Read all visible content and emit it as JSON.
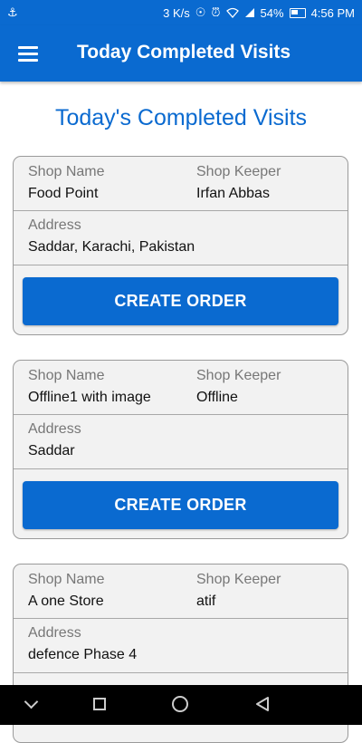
{
  "status_bar": {
    "speed": "3 K/s",
    "battery": "54%",
    "time": "4:56 PM"
  },
  "app_bar": {
    "title": "Today Completed Visits"
  },
  "page": {
    "heading": "Today's Completed Visits"
  },
  "labels": {
    "shop_name": "Shop Name",
    "shop_keeper": "Shop Keeper",
    "address": "Address",
    "create_order": "CREATE ORDER"
  },
  "visits": [
    {
      "shop_name": "Food Point",
      "shop_keeper": "Irfan Abbas",
      "address": "Saddar, Karachi, Pakistan"
    },
    {
      "shop_name": "Offline1 with image",
      "shop_keeper": "Offline",
      "address": "Saddar"
    },
    {
      "shop_name": "A one Store",
      "shop_keeper": "atif",
      "address": "defence Phase 4"
    }
  ],
  "colors": {
    "primary": "#0a6ad0",
    "card_bg": "#f2f2f2",
    "label": "#777777"
  },
  "icons": [
    "usb-icon",
    "alarm-icon",
    "wifi-icon",
    "signal-icon",
    "battery-icon",
    "menu-icon",
    "nav-back-icon",
    "nav-home-icon",
    "nav-recents-icon",
    "nav-down-icon"
  ]
}
